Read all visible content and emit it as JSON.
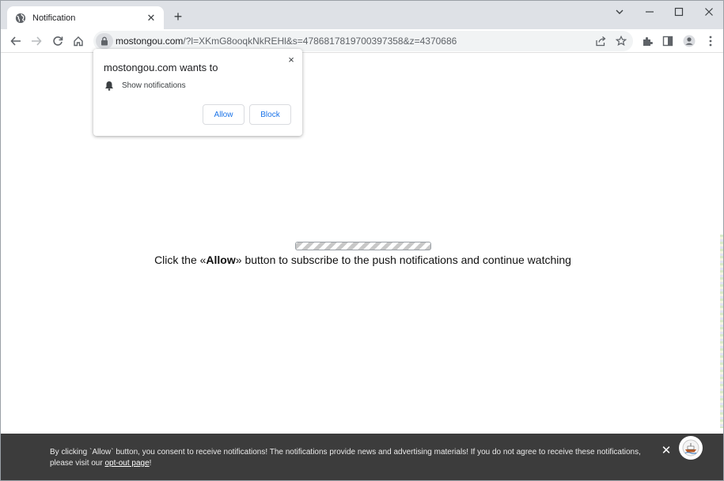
{
  "browser": {
    "tab": {
      "title": "Notification",
      "icon": "globe-icon"
    },
    "new_tab_label": "+",
    "window_controls": [
      "chevron-down-icon",
      "minimize-icon",
      "maximize-icon",
      "close-icon"
    ],
    "toolbar_icons": [
      "back-icon",
      "forward-icon",
      "reload-icon",
      "home-icon"
    ],
    "address": {
      "host": "mostongou.com",
      "path": "/?l=XKmG8ooqkNkREHl&s=4786817819700397358&z=4370686"
    },
    "right_icons": [
      "share-icon",
      "star-icon",
      "extensions-icon",
      "side-panel-icon",
      "profile-icon",
      "menu-icon"
    ]
  },
  "permission_popup": {
    "title": "mostongou.com wants to",
    "item_label": "Show notifications",
    "item_icon": "bell-icon",
    "allow_label": "Allow",
    "block_label": "Block",
    "close_label": "×"
  },
  "page": {
    "cta_before": "Click the «",
    "cta_bold": "Allow",
    "cta_after": "» button to subscribe to the push notifications and continue watching"
  },
  "consent_bar": {
    "text_before": "By clicking `Allow` button, you consent to receive notifications! The notifications provide news and advertising materials! If you do not agree to receive these notifications, please visit our ",
    "link_label": "opt-out page",
    "text_after": "!",
    "close_label": "✕",
    "logo_icon": "ship-logo-icon"
  },
  "colors": {
    "accent": "#1a73e8",
    "consent_background": "#3c3c3c",
    "tabstrip": "#dee1e6"
  }
}
